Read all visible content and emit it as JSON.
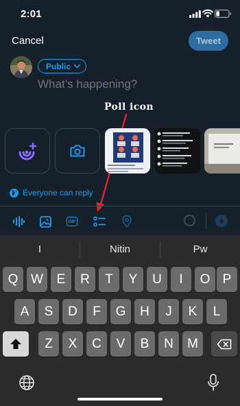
{
  "status_bar": {
    "time": "2:01"
  },
  "header": {
    "cancel_label": "Cancel",
    "tweet_label": "Tweet"
  },
  "compose": {
    "audience_label": "Public",
    "placeholder": "What’s happening?"
  },
  "annotation": {
    "text": "Poll icon",
    "color": "#e0242b"
  },
  "reply_setting": {
    "label": "Everyone can reply"
  },
  "toolbar": {
    "icons": [
      "audio-space-icon",
      "image-icon",
      "gif-icon",
      "poll-icon",
      "location-icon"
    ]
  },
  "keyboard": {
    "suggestions": [
      "I",
      "Nitin",
      "Pw"
    ],
    "row1": [
      "Q",
      "W",
      "E",
      "R",
      "T",
      "Y",
      "U",
      "I",
      "O",
      "P"
    ],
    "row2": [
      "A",
      "S",
      "D",
      "F",
      "G",
      "H",
      "J",
      "K",
      "L"
    ],
    "row3": [
      "Z",
      "X",
      "C",
      "V",
      "B",
      "N",
      "M"
    ]
  },
  "colors": {
    "background": "#15202b",
    "accent": "#1d9bf0",
    "keyboard_bg": "#2b2b2d",
    "key": "#6b6b6e"
  }
}
